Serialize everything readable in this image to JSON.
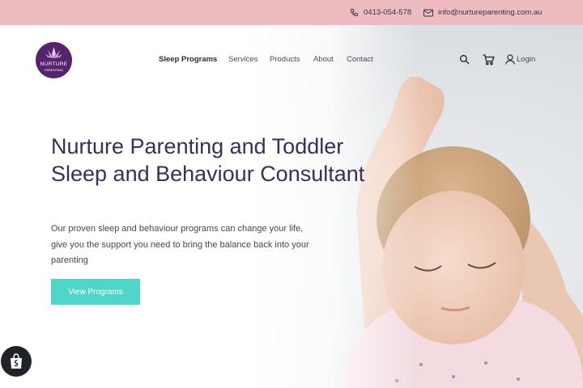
{
  "topbar": {
    "phone": "0413-054-578",
    "email": "info@nurtureparenting.com.au",
    "phone_icon": "phone-icon",
    "email_icon": "mail-icon"
  },
  "brand": {
    "logo_text": "NURTURE",
    "logo_sub": "PARENTING",
    "color": "#55246d"
  },
  "nav": {
    "items": [
      "Sleep Programs",
      "Services",
      "Products",
      "About",
      "Contact"
    ],
    "active": "Sleep Programs"
  },
  "actions": {
    "search_icon": "search-icon",
    "cart_icon": "cart-icon",
    "user_icon": "user-icon",
    "login_label": "Login"
  },
  "hero": {
    "title": "Nurture Parenting and Toddler Sleep and Behaviour Consultant",
    "subtitle": "Our proven sleep and behaviour programs can change your life, give you the support you need to bring the balance back into your parenting",
    "cta_label": "View Programs",
    "cta_color": "#4fd6c8",
    "image": "sleeping-baby-photo"
  },
  "badge": {
    "icon": "shopify-bag-icon"
  },
  "colors": {
    "topbar": "#eebcc0",
    "heading": "#3d2e55"
  }
}
